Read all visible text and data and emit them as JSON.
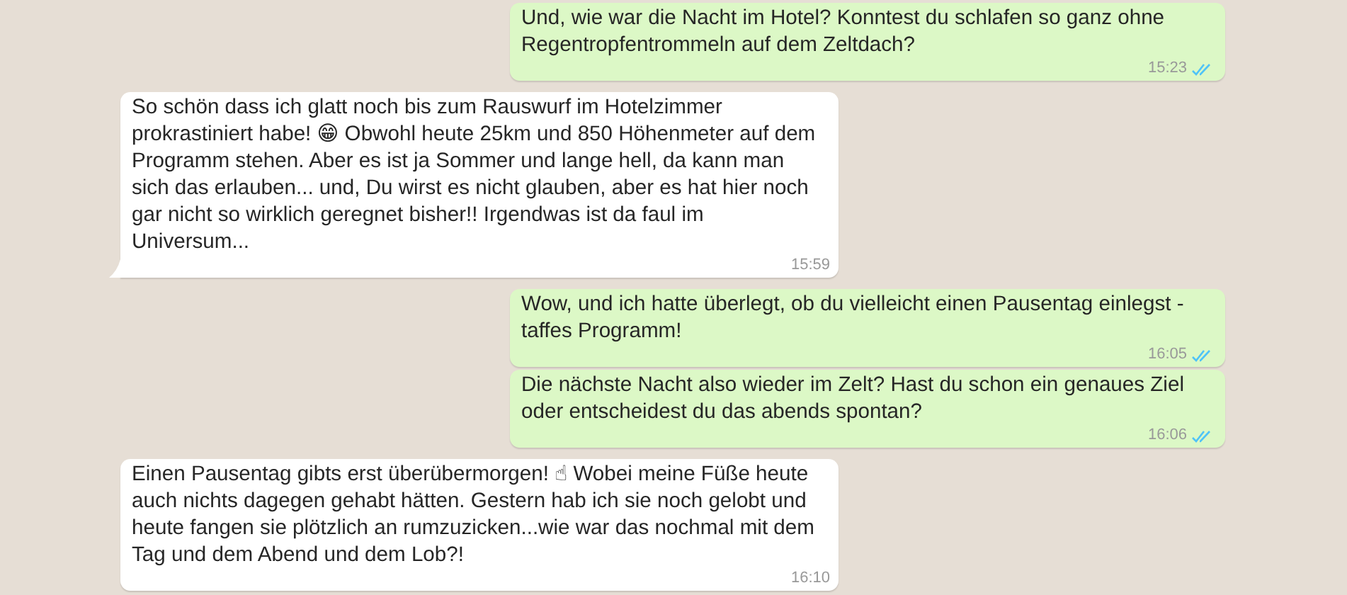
{
  "messages": [
    {
      "outgoing": true,
      "tail": false,
      "text": "Und, wie war die Nacht im Hotel? Konntest du schlafen so ganz ohne Regentropfentrommeln auf dem Zeltdach?",
      "time": "15:23",
      "read": true
    },
    {
      "outgoing": false,
      "tail": true,
      "text": "So schön dass ich glatt noch bis zum Rauswurf im Hotelzimmer prokrastiniert habe! 😁 Obwohl heute 25km und 850 Höhenmeter auf dem Programm stehen. Aber es ist ja Sommer und lange hell, da kann man sich das erlauben... und, Du wirst es nicht glauben, aber es hat hier noch gar nicht so wirklich geregnet bisher!! Irgendwas ist da faul im Universum...",
      "time": "15:59"
    },
    {
      "outgoing": true,
      "tail": false,
      "text": "Wow, und ich hatte überlegt, ob du vielleicht einen Pausentag einlegst - taffes Programm!",
      "time": "16:05",
      "read": true
    },
    {
      "outgoing": true,
      "tail": false,
      "text": "Die nächste Nacht also wieder im Zelt? Hast du schon ein genaues Ziel oder entscheidest du das abends spontan?",
      "time": "16:06",
      "read": true
    },
    {
      "outgoing": false,
      "tail": false,
      "text": "Einen Pausentag gibts erst überübermorgen! ☝ Wobei meine Füße heute auch nichts dagegen gehabt hätten. Gestern hab ich sie noch gelobt und heute fangen sie plötzlich an rumzuzicken...wie war das nochmal mit dem Tag und dem Abend und dem Lob?!",
      "time": "16:10"
    }
  ]
}
